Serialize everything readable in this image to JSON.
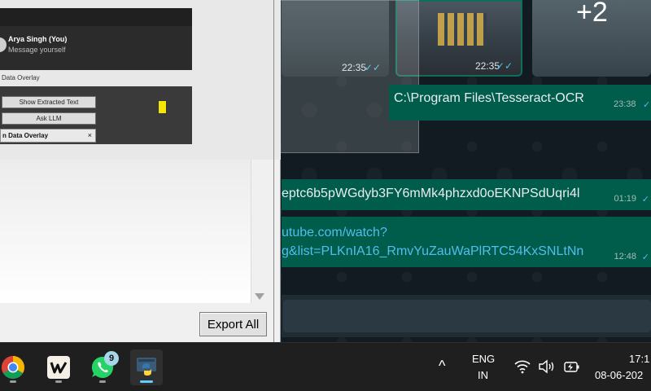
{
  "whatsapp": {
    "thumbnails": [
      {
        "time": "22:35",
        "tick": "✓✓"
      },
      {
        "time": "22:35",
        "tick": "✓✓"
      },
      {
        "more_count": "+2"
      }
    ],
    "messages": [
      {
        "text": "C:\\Program Files\\Tesseract-OCR",
        "time": "23:38",
        "tick": "✓"
      },
      {
        "text": "eptc6b5pWGdyb3FY6mMk4phzxd0oEKNPSdUqri4l",
        "time": "01:19",
        "tick": "✓"
      },
      {
        "line1": "utube.com/watch?",
        "line2": "g&list=PLKnIA16_RmvYuZauWaPlRTC54KxSNLtNn",
        "time": "12:48",
        "tick": "✓"
      }
    ]
  },
  "app": {
    "export_label": "Export All",
    "preview": {
      "contact_name": "Arya Singh (You)",
      "contact_sub": "Message yourself",
      "section_label": "Data Overlay",
      "show_text_label": "Show Extracted Text",
      "ask_llm_label": "Ask LLM",
      "overlay_bar_label": "n Data Overlay",
      "overlay_close": "×"
    }
  },
  "taskbar": {
    "apps": [
      {
        "icon": "chrome-icon"
      },
      {
        "icon": "winget-w-icon"
      },
      {
        "icon": "whatsapp-icon",
        "badge": "9"
      },
      {
        "icon": "python-icon",
        "active": true
      }
    ],
    "tray": {
      "chevron": "^",
      "lang_top": "ENG",
      "lang_bottom": "IN",
      "time": "17:1",
      "date": "08-06-202"
    }
  },
  "colors": {
    "whatsapp_bubble": "#005c4b",
    "whatsapp_bg": "#111b21",
    "link": "#53bdeb",
    "taskbar": "#1f1f1f"
  }
}
